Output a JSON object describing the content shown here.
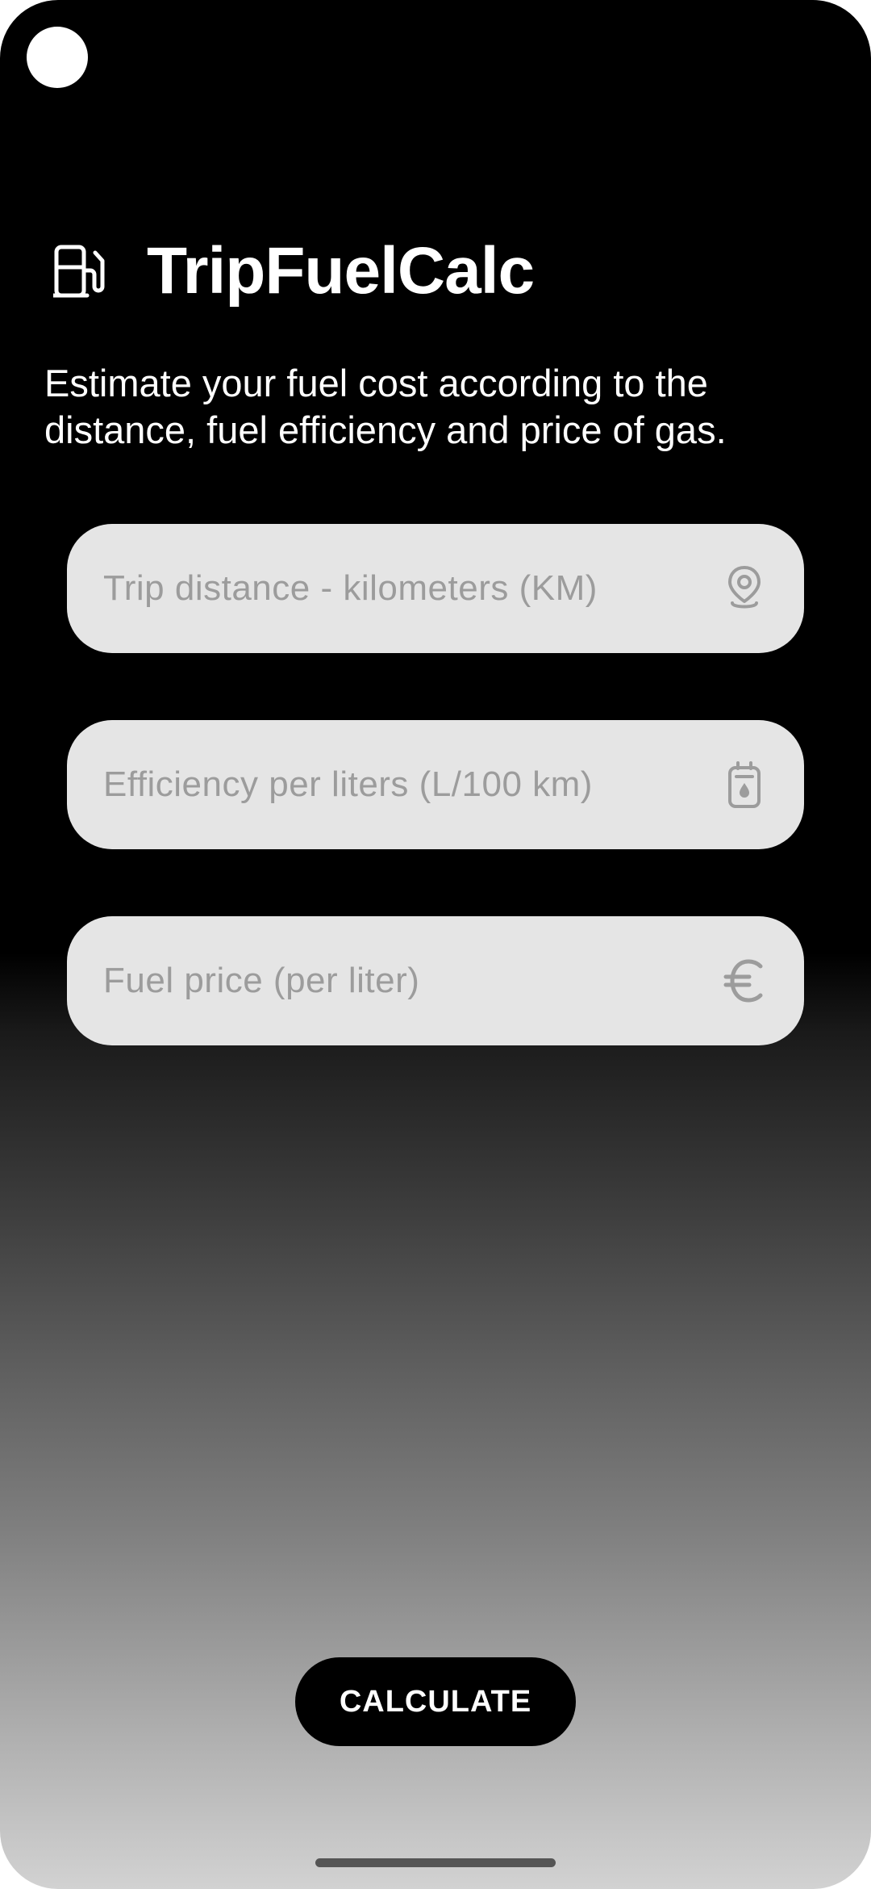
{
  "app": {
    "title": "TripFuelCalc",
    "logo_icon": "fuel-pump-icon",
    "description": "Estimate your fuel cost according to the distance, fuel efficiency and price of gas."
  },
  "fields": [
    {
      "placeholder": "Trip distance - kilometers (KM)",
      "value": "",
      "icon": "location-pin-icon"
    },
    {
      "placeholder": "Efficiency per liters (L/100 km)",
      "value": "",
      "icon": "fuel-canister-icon"
    },
    {
      "placeholder": "Fuel price (per liter)",
      "value": "",
      "icon": "euro-icon"
    }
  ],
  "actions": {
    "calculate_label": "CALCULATE"
  },
  "colors": {
    "field_background": "#e5e5e5",
    "placeholder_text": "#9c9c9c",
    "button_background": "#000000",
    "button_text": "#ffffff",
    "header_text": "#ffffff"
  }
}
